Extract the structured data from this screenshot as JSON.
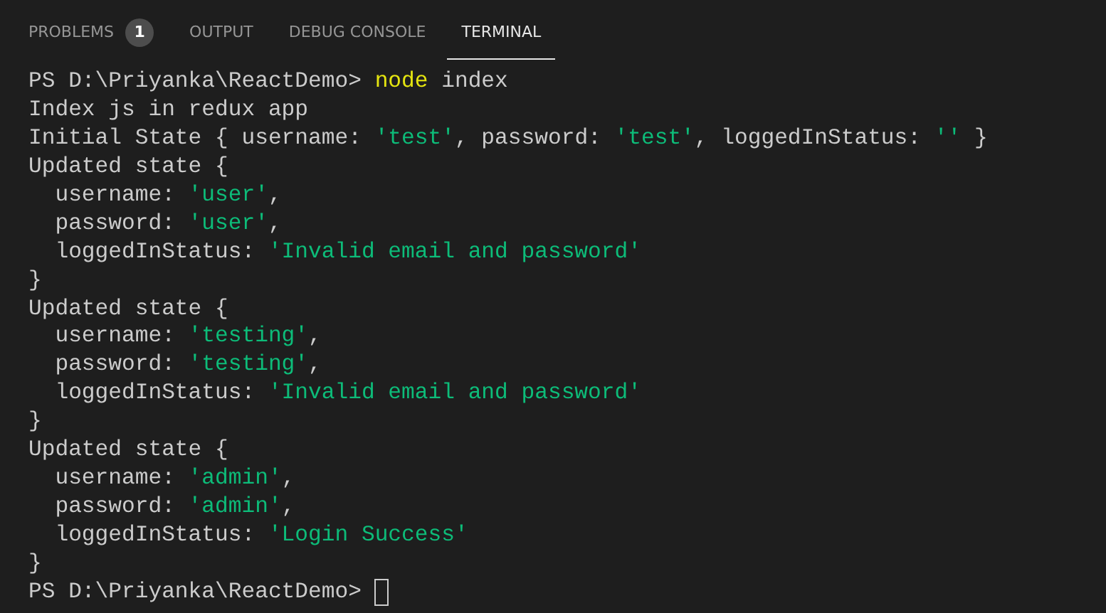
{
  "tabs": [
    {
      "label": "PROBLEMS",
      "badge": "1",
      "selected": false
    },
    {
      "label": "OUTPUT",
      "selected": false
    },
    {
      "label": "DEBUG CONSOLE",
      "selected": false
    },
    {
      "label": "TERMINAL",
      "selected": true
    }
  ],
  "terminal": {
    "lines": [
      [
        {
          "text": "PS D:\\Priyanka\\ReactDemo> ",
          "kind": "plain"
        },
        {
          "text": "node",
          "kind": "command"
        },
        {
          "text": " index",
          "kind": "plain"
        }
      ],
      [
        {
          "text": "Index js in redux app",
          "kind": "plain"
        }
      ],
      [
        {
          "text": "Initial State { username: ",
          "kind": "plain"
        },
        {
          "text": "'test'",
          "kind": "string"
        },
        {
          "text": ", password: ",
          "kind": "plain"
        },
        {
          "text": "'test'",
          "kind": "string"
        },
        {
          "text": ", loggedInStatus: ",
          "kind": "plain"
        },
        {
          "text": "''",
          "kind": "string"
        },
        {
          "text": " }",
          "kind": "plain"
        }
      ],
      [
        {
          "text": "Updated state {",
          "kind": "plain"
        }
      ],
      [
        {
          "text": "  username: ",
          "kind": "plain"
        },
        {
          "text": "'user'",
          "kind": "string"
        },
        {
          "text": ",",
          "kind": "plain"
        }
      ],
      [
        {
          "text": "  password: ",
          "kind": "plain"
        },
        {
          "text": "'user'",
          "kind": "string"
        },
        {
          "text": ",",
          "kind": "plain"
        }
      ],
      [
        {
          "text": "  loggedInStatus: ",
          "kind": "plain"
        },
        {
          "text": "'Invalid email and password'",
          "kind": "string"
        }
      ],
      [
        {
          "text": "}",
          "kind": "plain"
        }
      ],
      [
        {
          "text": "Updated state {",
          "kind": "plain"
        }
      ],
      [
        {
          "text": "  username: ",
          "kind": "plain"
        },
        {
          "text": "'testing'",
          "kind": "string"
        },
        {
          "text": ",",
          "kind": "plain"
        }
      ],
      [
        {
          "text": "  password: ",
          "kind": "plain"
        },
        {
          "text": "'testing'",
          "kind": "string"
        },
        {
          "text": ",",
          "kind": "plain"
        }
      ],
      [
        {
          "text": "  loggedInStatus: ",
          "kind": "plain"
        },
        {
          "text": "'Invalid email and password'",
          "kind": "string"
        }
      ],
      [
        {
          "text": "}",
          "kind": "plain"
        }
      ],
      [
        {
          "text": "Updated state {",
          "kind": "plain"
        }
      ],
      [
        {
          "text": "  username: ",
          "kind": "plain"
        },
        {
          "text": "'admin'",
          "kind": "string"
        },
        {
          "text": ",",
          "kind": "plain"
        }
      ],
      [
        {
          "text": "  password: ",
          "kind": "plain"
        },
        {
          "text": "'admin'",
          "kind": "string"
        },
        {
          "text": ",",
          "kind": "plain"
        }
      ],
      [
        {
          "text": "  loggedInStatus: ",
          "kind": "plain"
        },
        {
          "text": "'Login Success'",
          "kind": "string"
        }
      ],
      [
        {
          "text": "}",
          "kind": "plain"
        }
      ],
      [
        {
          "text": "PS D:\\Priyanka\\ReactDemo> ",
          "kind": "plain"
        }
      ]
    ],
    "cursor": true
  }
}
